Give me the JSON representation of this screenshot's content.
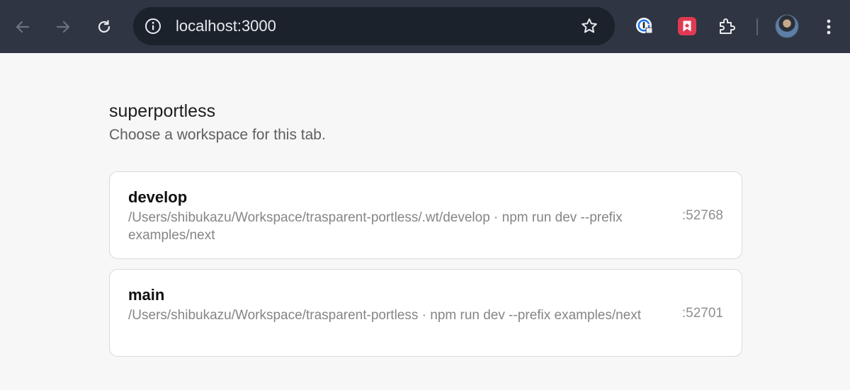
{
  "browser": {
    "url": "localhost:3000",
    "icons": {
      "back": "arrow-left-icon",
      "forward": "arrow-right-icon",
      "reload": "reload-icon",
      "site_info": "info-icon",
      "bookmark": "star-icon",
      "extension_1": "password-manager-icon",
      "extension_2": "bookmark-extension-icon",
      "extensions": "puzzle-icon",
      "menu": "more-vertical-icon"
    },
    "colors": {
      "toolbar": "#2f3542",
      "omnibox": "#1c222c",
      "extension_red": "#e03a52"
    }
  },
  "page": {
    "title": "superportless",
    "subtitle": "Choose a workspace for this tab.",
    "workspaces": [
      {
        "name": "develop",
        "detail": "/Users/shibukazu/Workspace/trasparent-portless/.wt/develop · npm run dev --prefix examples/next",
        "port": ":52768"
      },
      {
        "name": "main",
        "detail": "/Users/shibukazu/Workspace/trasparent-portless · npm run dev --prefix examples/next",
        "port": ":52701"
      }
    ]
  }
}
